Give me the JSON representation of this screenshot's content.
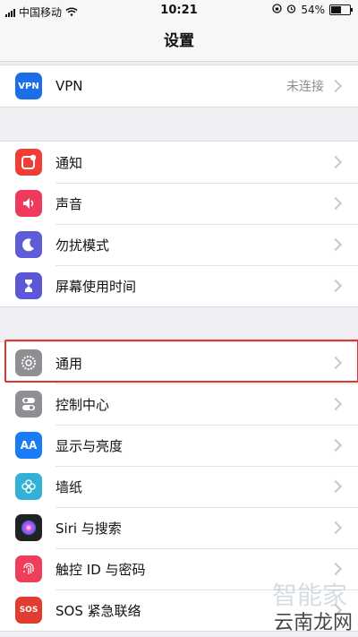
{
  "status": {
    "carrier": "中国移动",
    "time": "10:21",
    "battery": "54%",
    "battery_level": 0.54
  },
  "nav": {
    "title": "设置"
  },
  "vpn": {
    "label": "VPN",
    "value": "未连接",
    "icon_text": "VPN"
  },
  "group2": [
    {
      "label": "通知",
      "icon": "notifications-icon",
      "color": "#f03e36"
    },
    {
      "label": "声音",
      "icon": "sound-icon",
      "color": "#ef3a5d"
    },
    {
      "label": "勿扰模式",
      "icon": "moon-icon",
      "color": "#5f5cd8"
    },
    {
      "label": "屏幕使用时间",
      "icon": "hourglass-icon",
      "color": "#5c58d5"
    }
  ],
  "group3": [
    {
      "label": "通用",
      "icon": "gear-icon",
      "color": "#8e8e93"
    },
    {
      "label": "控制中心",
      "icon": "toggles-icon",
      "color": "#8e8e93"
    },
    {
      "label": "显示与亮度",
      "icon": "display-icon",
      "color": "#1a7cf5",
      "icon_text": "AA"
    },
    {
      "label": "墙纸",
      "icon": "flower-icon",
      "color": "#34b0d6"
    },
    {
      "label": "Siri 与搜索",
      "icon": "siri-icon",
      "color": "#222"
    },
    {
      "label": "触控 ID 与密码",
      "icon": "fingerprint-icon",
      "color": "#ef3d5a"
    },
    {
      "label": "SOS 紧急联络",
      "icon": "sos-icon",
      "color": "#e23b2f",
      "icon_text": "SOS"
    }
  ],
  "watermark": {
    "line1": "智能家",
    "line2": "云南龙网"
  }
}
